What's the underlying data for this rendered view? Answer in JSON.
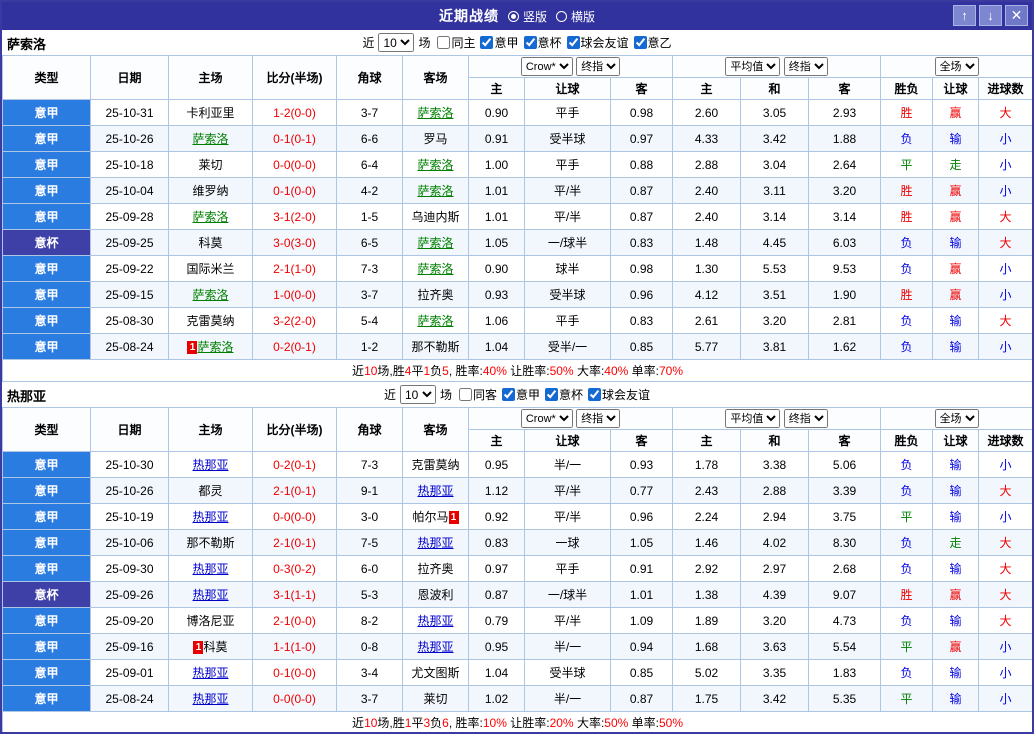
{
  "titlebar": {
    "title": "近期战绩",
    "vertical_label": "竖版",
    "horizontal_label": "横版",
    "up_icon": "↑",
    "down_icon": "↓",
    "close_icon": "✕"
  },
  "columns": [
    "类型",
    "日期",
    "主场",
    "比分(半场)",
    "角球",
    "客场",
    "主",
    "让球",
    "客",
    "主",
    "和",
    "客",
    "胜负",
    "让球",
    "进球数"
  ],
  "dropdowns": {
    "crow": "Crow*",
    "final_left": "终指",
    "average": "平均值",
    "final_right": "终指",
    "full_court": "全场"
  },
  "colors": {
    "win": "#f00000",
    "draw": "#008000",
    "loss": "#0000e0",
    "summary_red": "#ff0000",
    "summary_black": "#000000",
    "league_bg": "#2b7ce0",
    "cup_bg": "#3f3fa8"
  },
  "sections": [
    {
      "team": "萨索洛",
      "focus_color": "#008000",
      "filter": {
        "prefix": "近",
        "count": "10",
        "suffix": "场",
        "checkboxes": [
          {
            "label": "同主",
            "checked": false
          },
          {
            "label": "意甲",
            "checked": true
          },
          {
            "label": "意杯",
            "checked": true
          },
          {
            "label": "球会友谊",
            "checked": true
          },
          {
            "label": "意乙",
            "checked": true
          }
        ]
      },
      "rows": [
        {
          "type": "意甲",
          "date": "25-10-31",
          "home": "卡利亚里",
          "home_focus": false,
          "score": "1-2(0-0)",
          "corner": "3-7",
          "away": "萨索洛",
          "away_focus": true,
          "crow_home": "0.90",
          "handicap": "平手",
          "crow_away": "0.98",
          "avg_home": "2.60",
          "avg_draw": "3.05",
          "avg_away": "2.93",
          "result": "胜",
          "let_result": "赢",
          "goal_result": "大"
        },
        {
          "type": "意甲",
          "date": "25-10-26",
          "home": "萨索洛",
          "home_focus": true,
          "score": "0-1(0-1)",
          "corner": "6-6",
          "away": "罗马",
          "away_focus": false,
          "crow_home": "0.91",
          "handicap": "受半球",
          "crow_away": "0.97",
          "avg_home": "4.33",
          "avg_draw": "3.42",
          "avg_away": "1.88",
          "result": "负",
          "let_result": "输",
          "goal_result": "小"
        },
        {
          "type": "意甲",
          "date": "25-10-18",
          "home": "莱切",
          "home_focus": false,
          "score": "0-0(0-0)",
          "corner": "6-4",
          "away": "萨索洛",
          "away_focus": true,
          "crow_home": "1.00",
          "handicap": "平手",
          "crow_away": "0.88",
          "avg_home": "2.88",
          "avg_draw": "3.04",
          "avg_away": "2.64",
          "result": "平",
          "let_result": "走",
          "goal_result": "小"
        },
        {
          "type": "意甲",
          "date": "25-10-04",
          "home": "维罗纳",
          "home_focus": false,
          "score": "0-1(0-0)",
          "corner": "4-2",
          "away": "萨索洛",
          "away_focus": true,
          "crow_home": "1.01",
          "handicap": "平/半",
          "crow_away": "0.87",
          "avg_home": "2.40",
          "avg_draw": "3.11",
          "avg_away": "3.20",
          "result": "胜",
          "let_result": "赢",
          "goal_result": "小"
        },
        {
          "type": "意甲",
          "date": "25-09-28",
          "home": "萨索洛",
          "home_focus": true,
          "score": "3-1(2-0)",
          "corner": "1-5",
          "away": "乌迪内斯",
          "away_focus": false,
          "crow_home": "1.01",
          "handicap": "平/半",
          "crow_away": "0.87",
          "avg_home": "2.40",
          "avg_draw": "3.14",
          "avg_away": "3.14",
          "result": "胜",
          "let_result": "赢",
          "goal_result": "大"
        },
        {
          "type": "意杯",
          "date": "25-09-25",
          "home": "科莫",
          "home_focus": false,
          "score": "3-0(3-0)",
          "corner": "6-5",
          "away": "萨索洛",
          "away_focus": true,
          "crow_home": "1.05",
          "handicap": "一/球半",
          "crow_away": "0.83",
          "avg_home": "1.48",
          "avg_draw": "4.45",
          "avg_away": "6.03",
          "result": "负",
          "let_result": "输",
          "goal_result": "大"
        },
        {
          "type": "意甲",
          "date": "25-09-22",
          "home": "国际米兰",
          "home_focus": false,
          "score": "2-1(1-0)",
          "corner": "7-3",
          "away": "萨索洛",
          "away_focus": true,
          "crow_home": "0.90",
          "handicap": "球半",
          "crow_away": "0.98",
          "avg_home": "1.30",
          "avg_draw": "5.53",
          "avg_away": "9.53",
          "result": "负",
          "let_result": "赢",
          "goal_result": "小"
        },
        {
          "type": "意甲",
          "date": "25-09-15",
          "home": "萨索洛",
          "home_focus": true,
          "score": "1-0(0-0)",
          "corner": "3-7",
          "away": "拉齐奥",
          "away_focus": false,
          "crow_home": "0.93",
          "handicap": "受半球",
          "crow_away": "0.96",
          "avg_home": "4.12",
          "avg_draw": "3.51",
          "avg_away": "1.90",
          "result": "胜",
          "let_result": "赢",
          "goal_result": "小"
        },
        {
          "type": "意甲",
          "date": "25-08-30",
          "home": "克雷莫纳",
          "home_focus": false,
          "score": "3-2(2-0)",
          "corner": "5-4",
          "away": "萨索洛",
          "away_focus": true,
          "crow_home": "1.06",
          "handicap": "平手",
          "crow_away": "0.83",
          "avg_home": "2.61",
          "avg_draw": "3.20",
          "avg_away": "2.81",
          "result": "负",
          "let_result": "输",
          "goal_result": "大"
        },
        {
          "type": "意甲",
          "date": "25-08-24",
          "home": "萨索洛",
          "home_focus": true,
          "home_badge": "1",
          "home_badge_pos": "before",
          "score": "0-2(0-1)",
          "corner": "1-2",
          "away": "那不勒斯",
          "away_focus": false,
          "crow_home": "1.04",
          "handicap": "受半/一",
          "crow_away": "0.85",
          "avg_home": "5.77",
          "avg_draw": "3.81",
          "avg_away": "1.62",
          "result": "负",
          "let_result": "输",
          "goal_result": "小"
        }
      ],
      "summary": [
        {
          "t": "近",
          "c": "k"
        },
        {
          "t": "10",
          "c": "r"
        },
        {
          "t": "场,胜",
          "c": "k"
        },
        {
          "t": "4",
          "c": "r"
        },
        {
          "t": "平",
          "c": "k"
        },
        {
          "t": "1",
          "c": "r"
        },
        {
          "t": "负",
          "c": "k"
        },
        {
          "t": "5",
          "c": "r"
        },
        {
          "t": ", 胜率:",
          "c": "k"
        },
        {
          "t": "40%",
          "c": "r"
        },
        {
          "t": " 让胜率:",
          "c": "k"
        },
        {
          "t": "50%",
          "c": "r"
        },
        {
          "t": " 大率:",
          "c": "k"
        },
        {
          "t": "40%",
          "c": "r"
        },
        {
          "t": " 单率:",
          "c": "k"
        },
        {
          "t": "70%",
          "c": "r"
        }
      ]
    },
    {
      "team": "热那亚",
      "focus_color": "#0000cc",
      "filter": {
        "prefix": "近",
        "count": "10",
        "suffix": "场",
        "checkboxes": [
          {
            "label": "同客",
            "checked": false
          },
          {
            "label": "意甲",
            "checked": true
          },
          {
            "label": "意杯",
            "checked": true
          },
          {
            "label": "球会友谊",
            "checked": true
          }
        ]
      },
      "rows": [
        {
          "type": "意甲",
          "date": "25-10-30",
          "home": "热那亚",
          "home_focus": true,
          "score": "0-2(0-1)",
          "corner": "7-3",
          "away": "克雷莫纳",
          "away_focus": false,
          "crow_home": "0.95",
          "handicap": "半/一",
          "crow_away": "0.93",
          "avg_home": "1.78",
          "avg_draw": "3.38",
          "avg_away": "5.06",
          "result": "负",
          "let_result": "输",
          "goal_result": "小"
        },
        {
          "type": "意甲",
          "date": "25-10-26",
          "home": "都灵",
          "home_focus": false,
          "score": "2-1(0-1)",
          "corner": "9-1",
          "away": "热那亚",
          "away_focus": true,
          "crow_home": "1.12",
          "handicap": "平/半",
          "crow_away": "0.77",
          "avg_home": "2.43",
          "avg_draw": "2.88",
          "avg_away": "3.39",
          "result": "负",
          "let_result": "输",
          "goal_result": "大"
        },
        {
          "type": "意甲",
          "date": "25-10-19",
          "home": "热那亚",
          "home_focus": true,
          "score": "0-0(0-0)",
          "corner": "3-0",
          "away": "帕尔马",
          "away_focus": false,
          "away_badge": "1",
          "away_badge_pos": "after",
          "crow_home": "0.92",
          "handicap": "平/半",
          "crow_away": "0.96",
          "avg_home": "2.24",
          "avg_draw": "2.94",
          "avg_away": "3.75",
          "result": "平",
          "let_result": "输",
          "goal_result": "小"
        },
        {
          "type": "意甲",
          "date": "25-10-06",
          "home": "那不勒斯",
          "home_focus": false,
          "score": "2-1(0-1)",
          "corner": "7-5",
          "away": "热那亚",
          "away_focus": true,
          "crow_home": "0.83",
          "handicap": "一球",
          "crow_away": "1.05",
          "avg_home": "1.46",
          "avg_draw": "4.02",
          "avg_away": "8.30",
          "result": "负",
          "let_result": "走",
          "goal_result": "大"
        },
        {
          "type": "意甲",
          "date": "25-09-30",
          "home": "热那亚",
          "home_focus": true,
          "score": "0-3(0-2)",
          "corner": "6-0",
          "away": "拉齐奥",
          "away_focus": false,
          "crow_home": "0.97",
          "handicap": "平手",
          "crow_away": "0.91",
          "avg_home": "2.92",
          "avg_draw": "2.97",
          "avg_away": "2.68",
          "result": "负",
          "let_result": "输",
          "goal_result": "大"
        },
        {
          "type": "意杯",
          "date": "25-09-26",
          "home": "热那亚",
          "home_focus": true,
          "score": "3-1(1-1)",
          "corner": "5-3",
          "away": "恩波利",
          "away_focus": false,
          "crow_home": "0.87",
          "handicap": "一/球半",
          "crow_away": "1.01",
          "avg_home": "1.38",
          "avg_draw": "4.39",
          "avg_away": "9.07",
          "result": "胜",
          "let_result": "赢",
          "goal_result": "大"
        },
        {
          "type": "意甲",
          "date": "25-09-20",
          "home": "博洛尼亚",
          "home_focus": false,
          "score": "2-1(0-0)",
          "corner": "8-2",
          "away": "热那亚",
          "away_focus": true,
          "crow_home": "0.79",
          "handicap": "平/半",
          "crow_away": "1.09",
          "avg_home": "1.89",
          "avg_draw": "3.20",
          "avg_away": "4.73",
          "result": "负",
          "let_result": "输",
          "goal_result": "大"
        },
        {
          "type": "意甲",
          "date": "25-09-16",
          "home": "科莫",
          "home_focus": false,
          "home_badge": "1",
          "home_badge_pos": "before",
          "score": "1-1(1-0)",
          "corner": "0-8",
          "away": "热那亚",
          "away_focus": true,
          "crow_home": "0.95",
          "handicap": "半/一",
          "crow_away": "0.94",
          "avg_home": "1.68",
          "avg_draw": "3.63",
          "avg_away": "5.54",
          "result": "平",
          "let_result": "赢",
          "goal_result": "小"
        },
        {
          "type": "意甲",
          "date": "25-09-01",
          "home": "热那亚",
          "home_focus": true,
          "score": "0-1(0-0)",
          "corner": "3-4",
          "away": "尤文图斯",
          "away_focus": false,
          "crow_home": "1.04",
          "handicap": "受半球",
          "crow_away": "0.85",
          "avg_home": "5.02",
          "avg_draw": "3.35",
          "avg_away": "1.83",
          "result": "负",
          "let_result": "输",
          "goal_result": "小"
        },
        {
          "type": "意甲",
          "date": "25-08-24",
          "home": "热那亚",
          "home_focus": true,
          "score": "0-0(0-0)",
          "corner": "3-7",
          "away": "莱切",
          "away_focus": false,
          "crow_home": "1.02",
          "handicap": "半/一",
          "crow_away": "0.87",
          "avg_home": "1.75",
          "avg_draw": "3.42",
          "avg_away": "5.35",
          "result": "平",
          "let_result": "输",
          "goal_result": "小"
        }
      ],
      "summary": [
        {
          "t": "近",
          "c": "k"
        },
        {
          "t": "10",
          "c": "r"
        },
        {
          "t": "场,胜",
          "c": "k"
        },
        {
          "t": "1",
          "c": "r"
        },
        {
          "t": "平",
          "c": "k"
        },
        {
          "t": "3",
          "c": "r"
        },
        {
          "t": "负",
          "c": "k"
        },
        {
          "t": "6",
          "c": "r"
        },
        {
          "t": ", 胜率:",
          "c": "k"
        },
        {
          "t": "10%",
          "c": "r"
        },
        {
          "t": " 让胜率:",
          "c": "k"
        },
        {
          "t": "20%",
          "c": "r"
        },
        {
          "t": " 大率:",
          "c": "k"
        },
        {
          "t": "50%",
          "c": "r"
        },
        {
          "t": " 单率:",
          "c": "k"
        },
        {
          "t": "50%",
          "c": "r"
        }
      ]
    }
  ]
}
